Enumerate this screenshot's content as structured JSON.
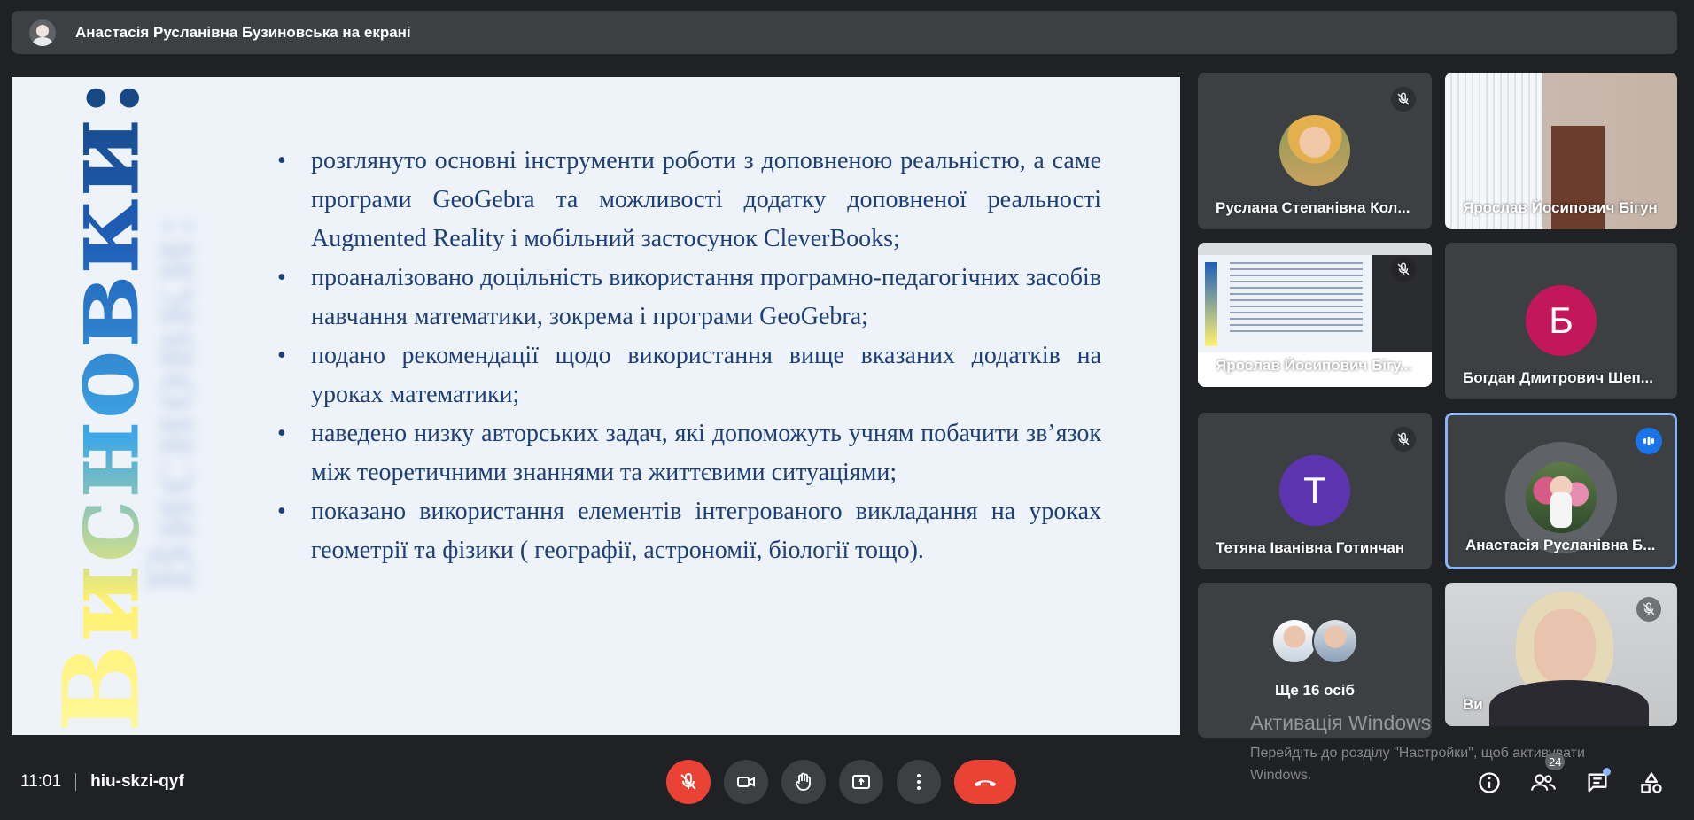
{
  "presenter_bar": {
    "title": "Анастасія Русланівна Бузиновська на екрані"
  },
  "slide": {
    "vertical_title": "Висновки:",
    "bullets": [
      "розглянуто основні інструменти роботи з доповненою реальністю, а саме програми GeoGebra та можливості додатку доповненої реальності Augmented Reality і мобільний застосунок CleverBooks;",
      "проаналізовано доцільність використання програмно-педагогічних засобів навчання математики, зокрема і програми GeoGebra;",
      "подано рекомендації щодо використання вище вказаних додатків на уроках математики;",
      "наведено низку авторських задач, які допоможуть учням побачити зв’язок між теоретичними знаннями та життєвими ситуаціями;",
      "показано використання елементів інтегрованого викладання на уроках геометрії та фізики ( географії, астрономії, біології тощо)."
    ]
  },
  "participants": [
    {
      "name": "Руслана Степанівна Кол...",
      "muted": true
    },
    {
      "name": "Ярослав Йосипович Бігун",
      "muted": false
    },
    {
      "name": "Ярослав Йосипович Бігу...",
      "muted": true
    },
    {
      "name": "Богдан Дмитрович Шеп...",
      "initial": "Б",
      "color": "#c2185b"
    },
    {
      "name": "Тетяна Іванівна Готинчан",
      "initial": "Т",
      "color": "#5e35b1",
      "muted": true
    },
    {
      "name": "Анастасія Русланівна Б...",
      "speaking": true
    },
    {
      "more_label": "Ще 16 осіб"
    },
    {
      "name": "Ви",
      "muted": true
    }
  ],
  "watermark": {
    "title": "Активація Windows",
    "subtitle": "Перейдіть до розділу \"Настройки\", щоб активувати Windows."
  },
  "bottom": {
    "time": "11:01",
    "meeting_code": "hiu-skzi-qyf",
    "participants_count": "24"
  },
  "colors": {
    "end_call": "#ea4335",
    "speaking": "#1a73e8",
    "background": "#202124",
    "tile": "#3c4043"
  }
}
